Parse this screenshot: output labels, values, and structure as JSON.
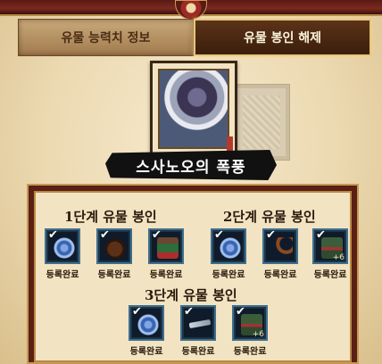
{
  "tabs": [
    {
      "label": "유물 능력치 정보",
      "active": false
    },
    {
      "label": "유물 봉인 해제",
      "active": true
    }
  ],
  "relic": {
    "name": "스사노오의 폭풍"
  },
  "stages": [
    {
      "title": "1단계 유물 봉인",
      "slots": [
        {
          "icon": "swirl-relic-icon",
          "status": "등록완료",
          "checked": true
        },
        {
          "icon": "leather-bag-icon",
          "status": "등록완료",
          "checked": true
        },
        {
          "icon": "armor-relic-icon",
          "status": "등록완료",
          "checked": true
        }
      ]
    },
    {
      "title": "2단계 유물 봉인",
      "slots": [
        {
          "icon": "swirl-relic-icon",
          "status": "등록완료",
          "checked": true
        },
        {
          "icon": "horn-relic-icon",
          "status": "등록완료",
          "checked": true
        },
        {
          "icon": "armor-relic-icon",
          "status": "등록완료",
          "checked": true,
          "enhance": "+6"
        }
      ]
    },
    {
      "title": "3단계 유물 봉인",
      "slots": [
        {
          "icon": "swirl-relic-icon",
          "status": "등록완료",
          "checked": true
        },
        {
          "icon": "blade-relic-icon",
          "status": "등록완료",
          "checked": true
        },
        {
          "icon": "armor-relic-icon",
          "status": "등록완료",
          "checked": true,
          "enhance": "+6"
        }
      ]
    }
  ],
  "colors": {
    "panel_border": "#5a1f15",
    "slot_border": "#3e6f8d",
    "tab_active": "#3b1e0c"
  }
}
